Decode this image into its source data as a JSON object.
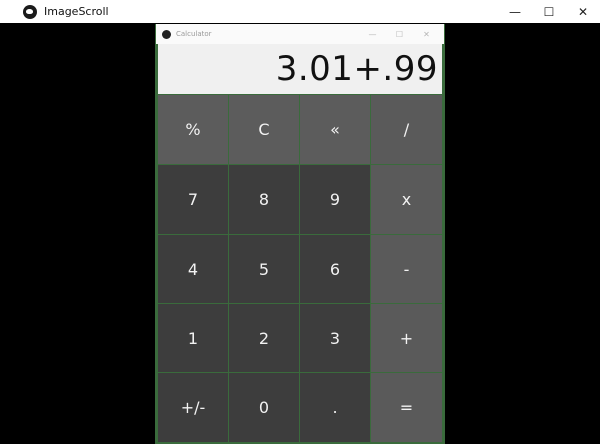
{
  "outer_window": {
    "title": "ImageScroll",
    "app_icon": "app-icon",
    "controls": {
      "minimize": "—",
      "maximize": "☐",
      "close": "✕"
    }
  },
  "calculator_window": {
    "title": "Calculator",
    "app_icon": "app-icon",
    "controls": {
      "minimize": "—",
      "maximize": "☐",
      "close": "✕"
    }
  },
  "display": {
    "value": "3.01+.99"
  },
  "keys": [
    {
      "label": "%",
      "kind": "top"
    },
    {
      "label": "C",
      "kind": "top"
    },
    {
      "label": "«",
      "kind": "top"
    },
    {
      "label": "/",
      "kind": "op"
    },
    {
      "label": "7",
      "kind": "num"
    },
    {
      "label": "8",
      "kind": "num"
    },
    {
      "label": "9",
      "kind": "num"
    },
    {
      "label": "x",
      "kind": "op"
    },
    {
      "label": "4",
      "kind": "num"
    },
    {
      "label": "5",
      "kind": "num"
    },
    {
      "label": "6",
      "kind": "num"
    },
    {
      "label": "-",
      "kind": "op"
    },
    {
      "label": "1",
      "kind": "num"
    },
    {
      "label": "2",
      "kind": "num"
    },
    {
      "label": "3",
      "kind": "num"
    },
    {
      "label": "+",
      "kind": "op"
    },
    {
      "label": "+/-",
      "kind": "num"
    },
    {
      "label": "0",
      "kind": "num"
    },
    {
      "label": ".",
      "kind": "num"
    },
    {
      "label": "=",
      "kind": "op"
    }
  ],
  "colors": {
    "key_dark": "#3d3d3d",
    "key_light": "#5a5a5a",
    "display_bg": "#f0f0f0",
    "window_border": "#3a6b3c"
  }
}
